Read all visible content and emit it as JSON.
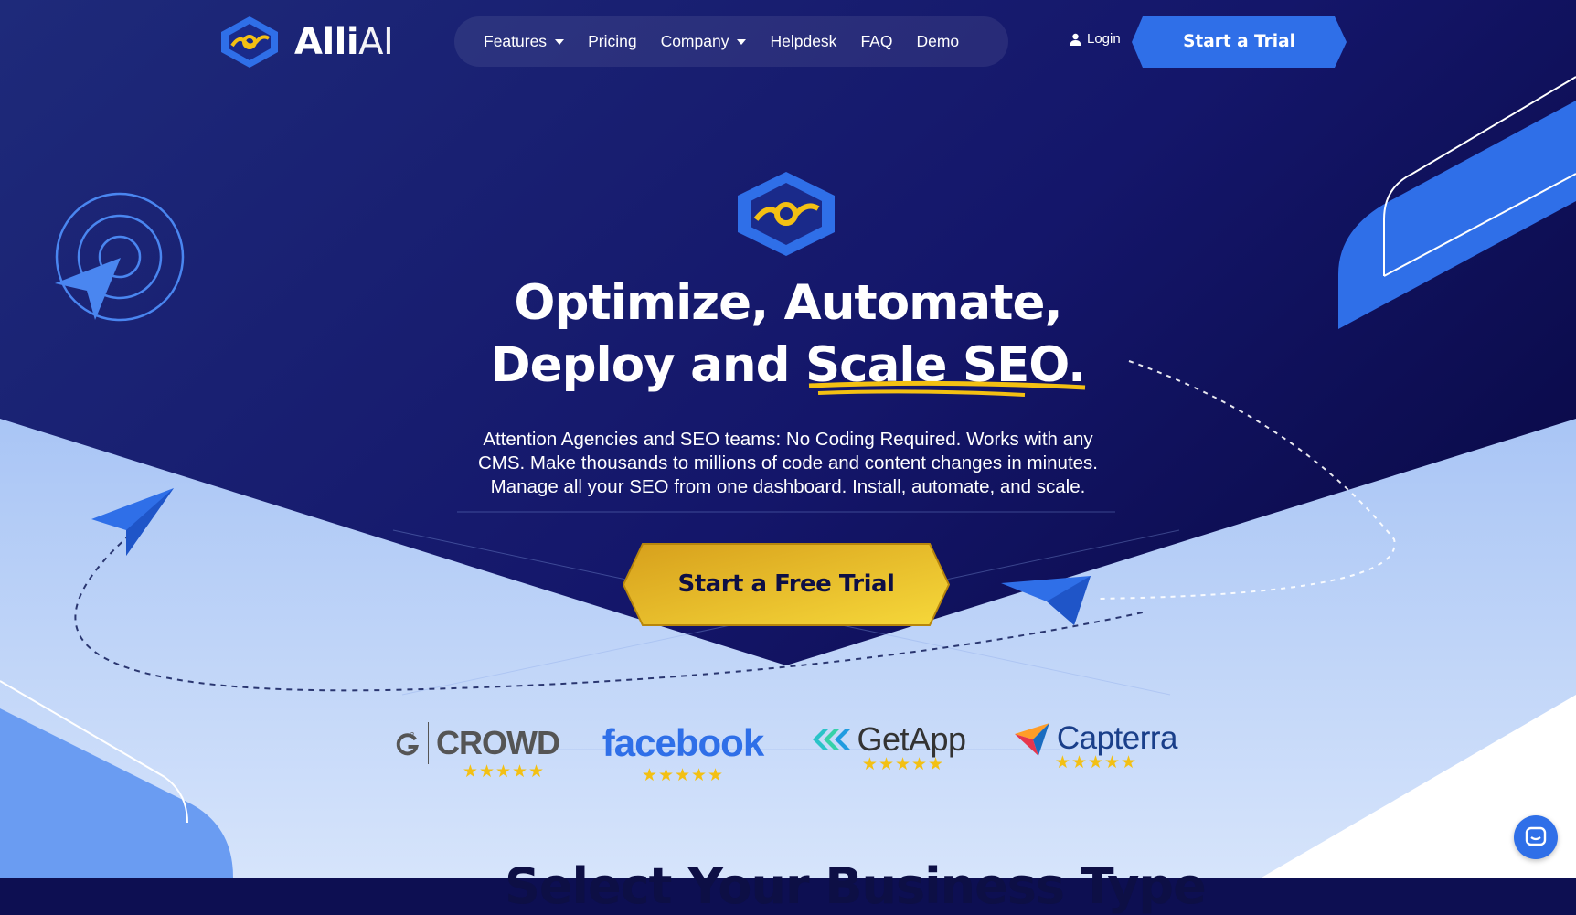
{
  "brand": {
    "name_bold": "Alli",
    "name_thin": "AI"
  },
  "nav": {
    "features": "Features",
    "pricing": "Pricing",
    "company": "Company",
    "helpdesk": "Helpdesk",
    "faq": "FAQ",
    "demo": "Demo"
  },
  "header": {
    "login": "Login",
    "trial": "Start a Trial"
  },
  "hero": {
    "headline_line1": "Optimize, Automate,",
    "headline_line2_start": "Deploy and ",
    "headline_highlight": "Scale SEO.",
    "subtext_line1": "Attention Agencies and SEO teams: No Coding Required. Works with any",
    "subtext_line2": "CMS. Make thousands to millions of code and content changes in minutes.",
    "subtext_line3": "Manage all your SEO from one dashboard. Install, automate, and scale.",
    "cta": "Start a Free Trial"
  },
  "reviews": {
    "g2": {
      "name": "CROWD",
      "stars": "★★★★★"
    },
    "facebook": {
      "name": "facebook",
      "stars": "★★★★★"
    },
    "getapp": {
      "name": "GetApp",
      "stars": "★★★★★"
    },
    "capterra": {
      "name": "Capterra",
      "stars": "★★★★★"
    }
  },
  "section": {
    "partial_title": "Select Your Business Type"
  },
  "colors": {
    "navy": "#0d0f52",
    "brand_blue": "#2f6fe8",
    "light_blue": "#b9cff6",
    "gold": "#f3c013"
  },
  "icons": [
    "alli-logo-icon",
    "user-icon",
    "caret-down-icon",
    "paper-plane-icon",
    "target-icon",
    "chat-icon"
  ]
}
